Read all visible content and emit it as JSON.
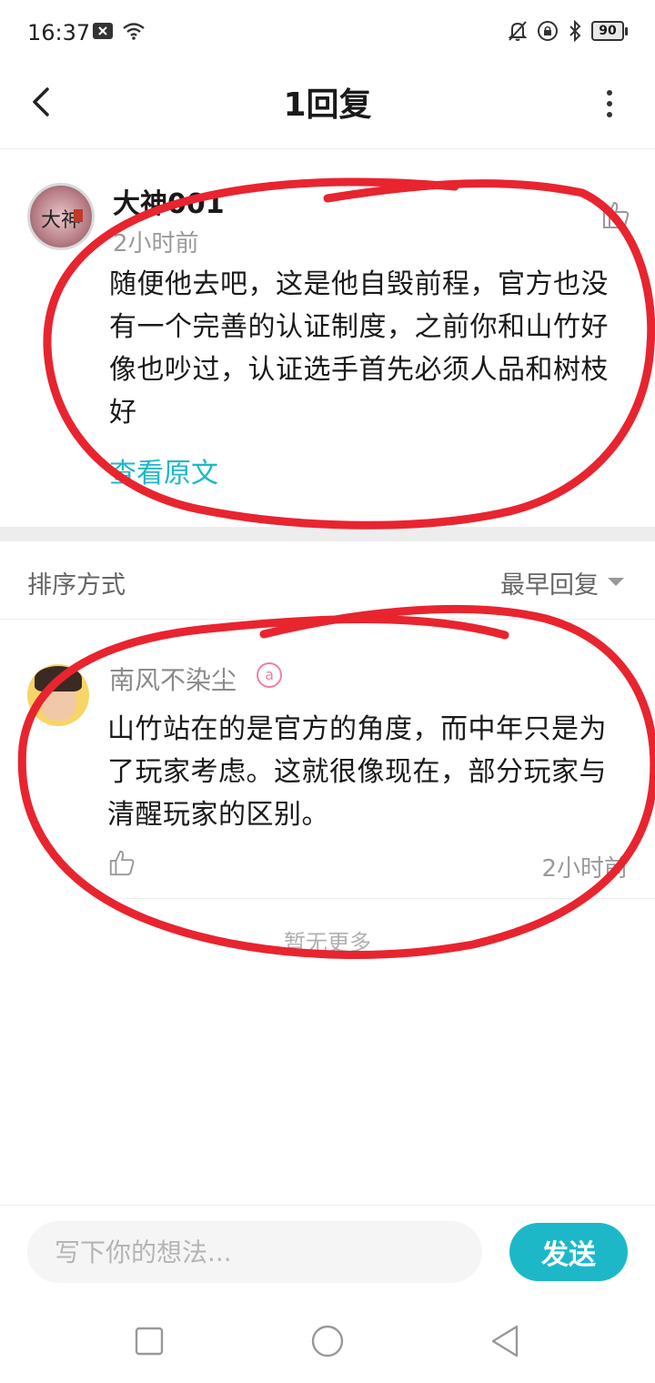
{
  "status_bar": {
    "time": "16:37",
    "battery": "90",
    "left_icons": [
      "notification-x-icon",
      "wifi-icon"
    ],
    "right_icons": [
      "mute-bell-icon",
      "rotation-lock-icon",
      "bluetooth-icon",
      "battery-icon"
    ]
  },
  "header": {
    "title": "1回复",
    "back_icon": "back-arrow-icon",
    "more_icon": "more-vertical-icon"
  },
  "main_comment": {
    "username": "大神001",
    "time": "2小时前",
    "avatar_text": "大神",
    "text": "随便他去吧，这是他自毁前程，官方也没有一个完善的认证制度，之前你和山竹好像也吵过，认证选手首先必须人品和树枝好",
    "view_original": "查看原文"
  },
  "sort": {
    "label": "排序方式",
    "value": "最早回复"
  },
  "replies": [
    {
      "username": "南风不染尘",
      "badge": "a",
      "text": "山竹站在的是官方的角度，而中年只是为了玩家考虑。这就很像现在，部分玩家与清醒玩家的区别。",
      "time": "2小时前"
    }
  ],
  "no_more": "暂无更多",
  "input": {
    "placeholder": "写下你的想法...",
    "send_label": "发送"
  },
  "colors": {
    "accent": "#1db8c8",
    "annotation": "#e8242f",
    "muted_text": "#9a9a9a"
  },
  "system_nav": [
    "recent-apps-icon",
    "home-icon",
    "back-triangle-icon"
  ]
}
